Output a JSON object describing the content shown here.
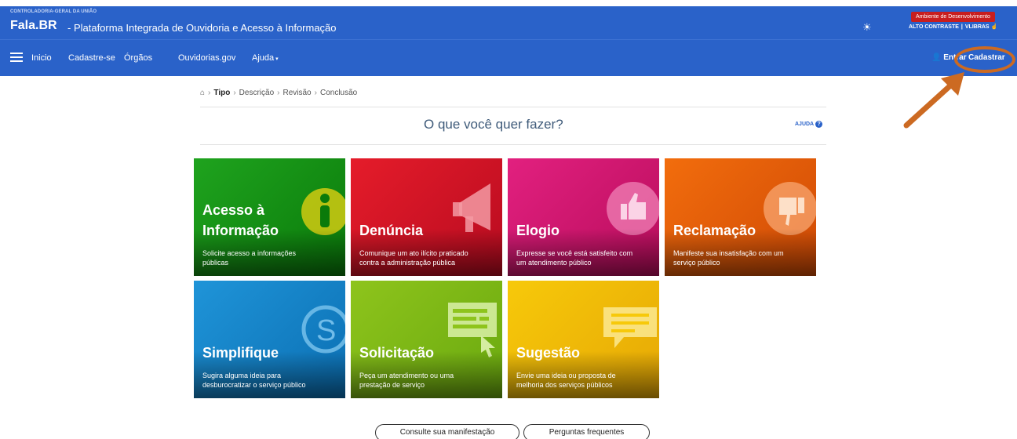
{
  "header": {
    "agency": "CONTROLADORIA-GERAL DA UNIÃO",
    "brand": "Fala.BR",
    "subtitle": "- Plataforma Integrada de Ouvidoria e Acesso à Informação",
    "env_badge": "Ambiente de Desenvolvimento",
    "high_contrast": "ALTO CONTRASTE",
    "vlibras": "VLIBRAS",
    "sun_icon": "sun-icon"
  },
  "nav": {
    "items": [
      "Inicio",
      "Cadastre-se",
      "Órgãos",
      "Ouvidorias.gov",
      "Ajuda"
    ],
    "enter": "Entrar",
    "register": "Cadastrar"
  },
  "breadcrumb": {
    "items": [
      "Tipo",
      "Descrição",
      "Revisão",
      "Conclusão"
    ]
  },
  "question": "O que você quer fazer?",
  "help_label": "AJUDA",
  "tiles": [
    {
      "title_1": "Acesso à",
      "title_2": "Informação",
      "desc_1": "Solicite acesso a informações",
      "desc_2": "públicas",
      "color": "#1fa31e"
    },
    {
      "title": "Denúncia",
      "desc_1": "Comunique um ato ilícito praticado",
      "desc_2": "contra a administração pública",
      "color": "#e51c2a"
    },
    {
      "title": "Elogio",
      "desc_1": "Expresse se você está satisfeito com",
      "desc_2": "um atendimento público",
      "color": "#e2207f"
    },
    {
      "title": "Reclamação",
      "desc_1": "Manifeste sua insatisfação com um",
      "desc_2": "serviço público",
      "color": "#f26d0d"
    },
    {
      "title": "Simplifique",
      "desc_1": "Sugira alguma ideia para",
      "desc_2": "desburocratizar o serviço público",
      "color": "#1f94d8"
    },
    {
      "title": "Solicitação",
      "desc_1": "Peça um atendimento ou uma",
      "desc_2": "prestação de serviço",
      "color": "#8ec41c"
    },
    {
      "title": "Sugestão",
      "desc_1": "Envie uma ideia ou proposta de",
      "desc_2": "melhoria dos serviços públicos",
      "color": "#f7c90a"
    }
  ],
  "buttons": {
    "consult": "Consulte sua manifestação",
    "faq": "Perguntas frequentes"
  },
  "colors": {
    "header": "#2a62c9",
    "annotation": "#cc6a22"
  }
}
